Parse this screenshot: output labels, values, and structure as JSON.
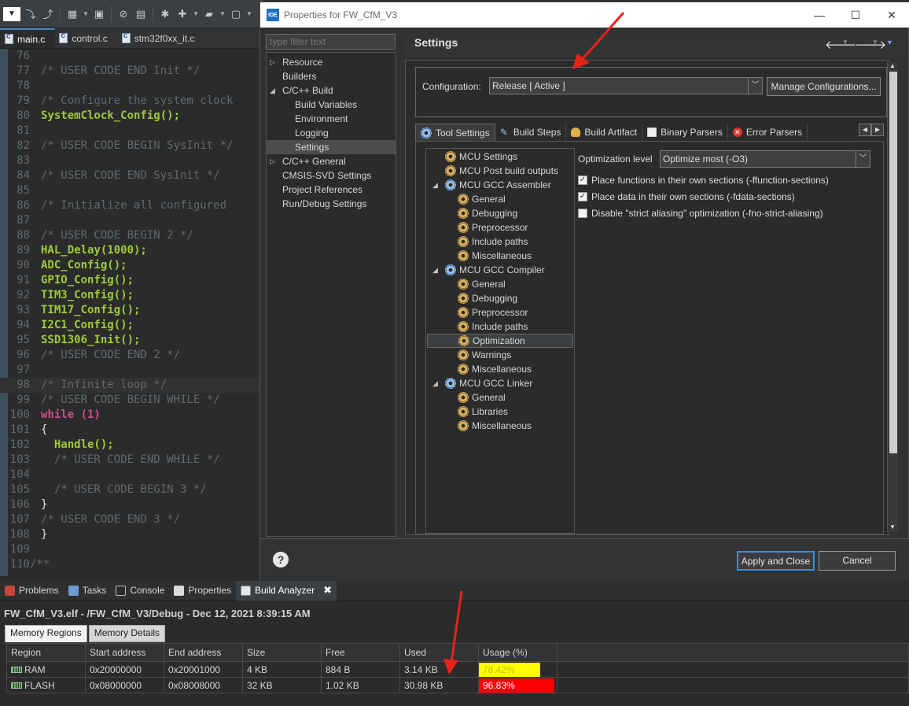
{
  "colors": {
    "accent": "#3d8fd6",
    "ram_usage": "#ffff00",
    "flash_usage": "#ff0000",
    "arrow": "#e8231b"
  },
  "editor_tabs": [
    {
      "label": "main.c"
    },
    {
      "label": "control.c"
    },
    {
      "label": "stm32f0xx_it.c"
    }
  ],
  "code_lines": [
    {
      "n": "76",
      "t": ""
    },
    {
      "n": "77",
      "t": "/* USER CODE END Init */"
    },
    {
      "n": "78",
      "t": ""
    },
    {
      "n": "79",
      "t": "/* Configure the system clock"
    },
    {
      "n": "80",
      "t": "SystemClock_Config();"
    },
    {
      "n": "81",
      "t": ""
    },
    {
      "n": "82",
      "t": "/* USER CODE BEGIN SysInit */"
    },
    {
      "n": "83",
      "t": ""
    },
    {
      "n": "84",
      "t": "/* USER CODE END SysInit */"
    },
    {
      "n": "85",
      "t": ""
    },
    {
      "n": "86",
      "t": "/* Initialize all configured"
    },
    {
      "n": "87",
      "t": ""
    },
    {
      "n": "88",
      "t": "/* USER CODE BEGIN 2 */"
    },
    {
      "n": "89",
      "t": "HAL_Delay(1000);"
    },
    {
      "n": "90",
      "t": "ADC_Config();"
    },
    {
      "n": "91",
      "t": "GPIO_Config();"
    },
    {
      "n": "92",
      "t": "TIM3_Config();"
    },
    {
      "n": "93",
      "t": "TIM17_Config();"
    },
    {
      "n": "94",
      "t": "I2C1_Config();"
    },
    {
      "n": "95",
      "t": "SSD1306_Init();"
    },
    {
      "n": "96",
      "t": "/* USER CODE END 2 */"
    },
    {
      "n": "97",
      "t": ""
    },
    {
      "n": "98",
      "t": "/* Infinite loop */"
    },
    {
      "n": "99",
      "t": "/* USER CODE BEGIN WHILE */"
    },
    {
      "n": "100",
      "t": "while (1)"
    },
    {
      "n": "101",
      "t": "{"
    },
    {
      "n": "102",
      "t": "  Handle();"
    },
    {
      "n": "103",
      "t": "  /* USER CODE END WHILE */"
    },
    {
      "n": "104",
      "t": ""
    },
    {
      "n": "105",
      "t": "  /* USER CODE BEGIN 3 */"
    },
    {
      "n": "106",
      "t": "}"
    },
    {
      "n": "107",
      "t": "/* USER CODE END 3 */"
    },
    {
      "n": "108",
      "t": "}"
    },
    {
      "n": "109",
      "t": ""
    },
    {
      "n": "110",
      "t": "/**"
    }
  ],
  "dialog": {
    "title": "Properties for FW_CfM_V3",
    "ide_badge": "IDE",
    "filter_placeholder": "type filter text",
    "nav": [
      {
        "label": "Resource",
        "arrow": "▷"
      },
      {
        "label": "Builders",
        "arrow": ""
      },
      {
        "label": "C/C++ Build",
        "arrow": "◢"
      },
      {
        "label": "Build Variables",
        "arrow": ""
      },
      {
        "label": "Environment",
        "arrow": ""
      },
      {
        "label": "Logging",
        "arrow": ""
      },
      {
        "label": "Settings",
        "arrow": ""
      },
      {
        "label": "C/C++ General",
        "arrow": "▷"
      },
      {
        "label": "CMSIS-SVD Settings",
        "arrow": ""
      },
      {
        "label": "Project References",
        "arrow": ""
      },
      {
        "label": "Run/Debug Settings",
        "arrow": ""
      }
    ],
    "settings_title": "Settings",
    "config_label": "Configuration:",
    "config_value": "Release  [ Active ]",
    "manage_label": "Manage Configurations...",
    "tool_tabs": [
      {
        "label": "Tool Settings"
      },
      {
        "label": "Build Steps"
      },
      {
        "label": "Build Artifact"
      },
      {
        "label": "Binary Parsers"
      },
      {
        "label": "Error Parsers"
      }
    ],
    "tree": [
      {
        "label": "MCU Settings"
      },
      {
        "label": "MCU Post build outputs"
      },
      {
        "label": "MCU GCC Assembler"
      },
      {
        "label": "General"
      },
      {
        "label": "Debugging"
      },
      {
        "label": "Preprocessor"
      },
      {
        "label": "Include paths"
      },
      {
        "label": "Miscellaneous"
      },
      {
        "label": "MCU GCC Compiler"
      },
      {
        "label": "General"
      },
      {
        "label": "Debugging"
      },
      {
        "label": "Preprocessor"
      },
      {
        "label": "Include paths"
      },
      {
        "label": "Optimization"
      },
      {
        "label": "Warnings"
      },
      {
        "label": "Miscellaneous"
      },
      {
        "label": "MCU GCC Linker"
      },
      {
        "label": "General"
      },
      {
        "label": "Libraries"
      },
      {
        "label": "Miscellaneous"
      }
    ],
    "opt_level_label": "Optimization level",
    "opt_level_value": "Optimize most (-O3)",
    "options": [
      {
        "label": "Place functions in their own sections (-ffunction-sections)",
        "checked": true
      },
      {
        "label": "Place data in their own sections (-fdata-sections)",
        "checked": true
      },
      {
        "label": "Disable \"strict aliasing\" optimization (-fno-strict-aliasing)",
        "checked": false
      }
    ],
    "help_glyph": "?",
    "apply_label": "Apply and Close",
    "cancel_label": "Cancel"
  },
  "views": {
    "tabs": [
      {
        "label": "Problems"
      },
      {
        "label": "Tasks"
      },
      {
        "label": "Console"
      },
      {
        "label": "Properties"
      },
      {
        "label": "Build Analyzer"
      }
    ],
    "close_glyph": "✖"
  },
  "build_analyzer": {
    "header": "FW_CfM_V3.elf - /FW_CfM_V3/Debug - Dec 12, 2021 8:39:15 AM",
    "tabs": [
      {
        "label": "Memory Regions"
      },
      {
        "label": "Memory Details"
      }
    ],
    "columns": [
      "Region",
      "Start address",
      "End address",
      "Size",
      "Free",
      "Used",
      "Usage (%)"
    ],
    "rows": [
      {
        "region": "RAM",
        "start": "0x20000000",
        "end": "0x20001000",
        "size": "4 KB",
        "free": "884 B",
        "used": "3.14 KB",
        "usage": "78.42%",
        "usage_pct": 78.42
      },
      {
        "region": "FLASH",
        "start": "0x08000000",
        "end": "0x08008000",
        "size": "32 KB",
        "free": "1.02 KB",
        "used": "30.98 KB",
        "usage": "96.83%",
        "usage_pct": 96.83
      }
    ]
  }
}
